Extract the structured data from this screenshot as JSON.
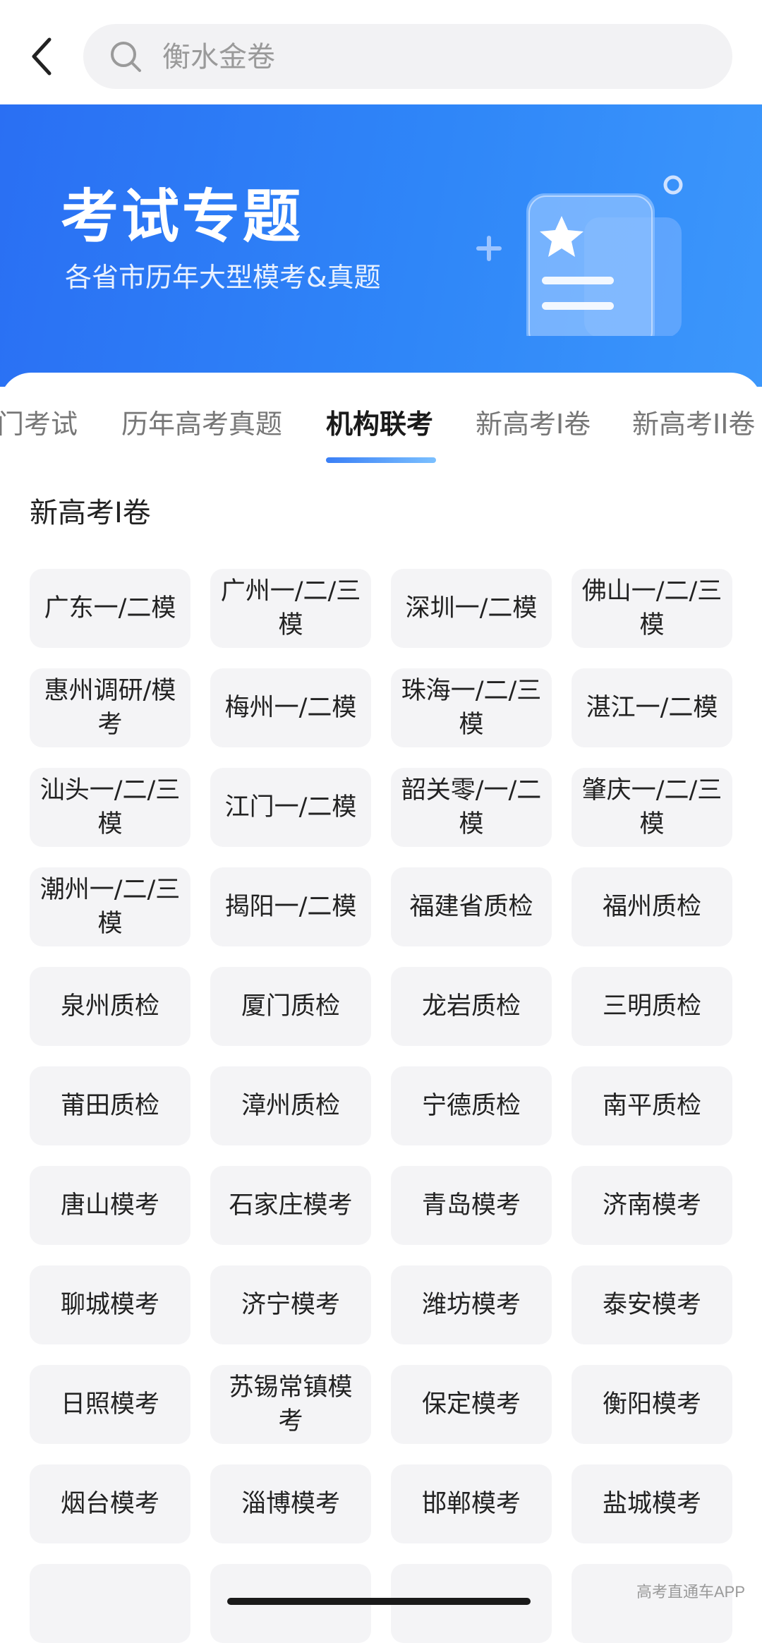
{
  "search": {
    "placeholder": "衡水金卷"
  },
  "banner": {
    "title": "考试专题",
    "subtitle": "各省市历年大型模考&真题",
    "accent": "#2f86f8"
  },
  "tabs": [
    {
      "label": "门考试",
      "active": false
    },
    {
      "label": "历年高考真题",
      "active": false
    },
    {
      "label": "机构联考",
      "active": true
    },
    {
      "label": "新高考I卷",
      "active": false
    },
    {
      "label": "新高考II卷",
      "active": false
    }
  ],
  "section": {
    "title": "新高考I卷"
  },
  "items": [
    "广东一/二模",
    "广州一/二/三模",
    "深圳一/二模",
    "佛山一/二/三模",
    "惠州调研/模考",
    "梅州一/二模",
    "珠海一/二/三模",
    "湛江一/二模",
    "汕头一/二/三模",
    "江门一/二模",
    "韶关零/一/二模",
    "肇庆一/二/三模",
    "潮州一/二/三模",
    "揭阳一/二模",
    "福建省质检",
    "福州质检",
    "泉州质检",
    "厦门质检",
    "龙岩质检",
    "三明质检",
    "莆田质检",
    "漳州质检",
    "宁德质检",
    "南平质检",
    "唐山模考",
    "石家庄模考",
    "青岛模考",
    "济南模考",
    "聊城模考",
    "济宁模考",
    "潍坊模考",
    "泰安模考",
    "日照模考",
    "苏锡常镇模考",
    "保定模考",
    "衡阳模考",
    "烟台模考",
    "淄博模考",
    "邯郸模考",
    "盐城模考",
    "",
    "",
    "",
    ""
  ],
  "watermark": "高考直通车APP",
  "icons": {
    "back": "chevron-left-icon",
    "search": "search-icon",
    "banner_art": "document-star-icon"
  }
}
